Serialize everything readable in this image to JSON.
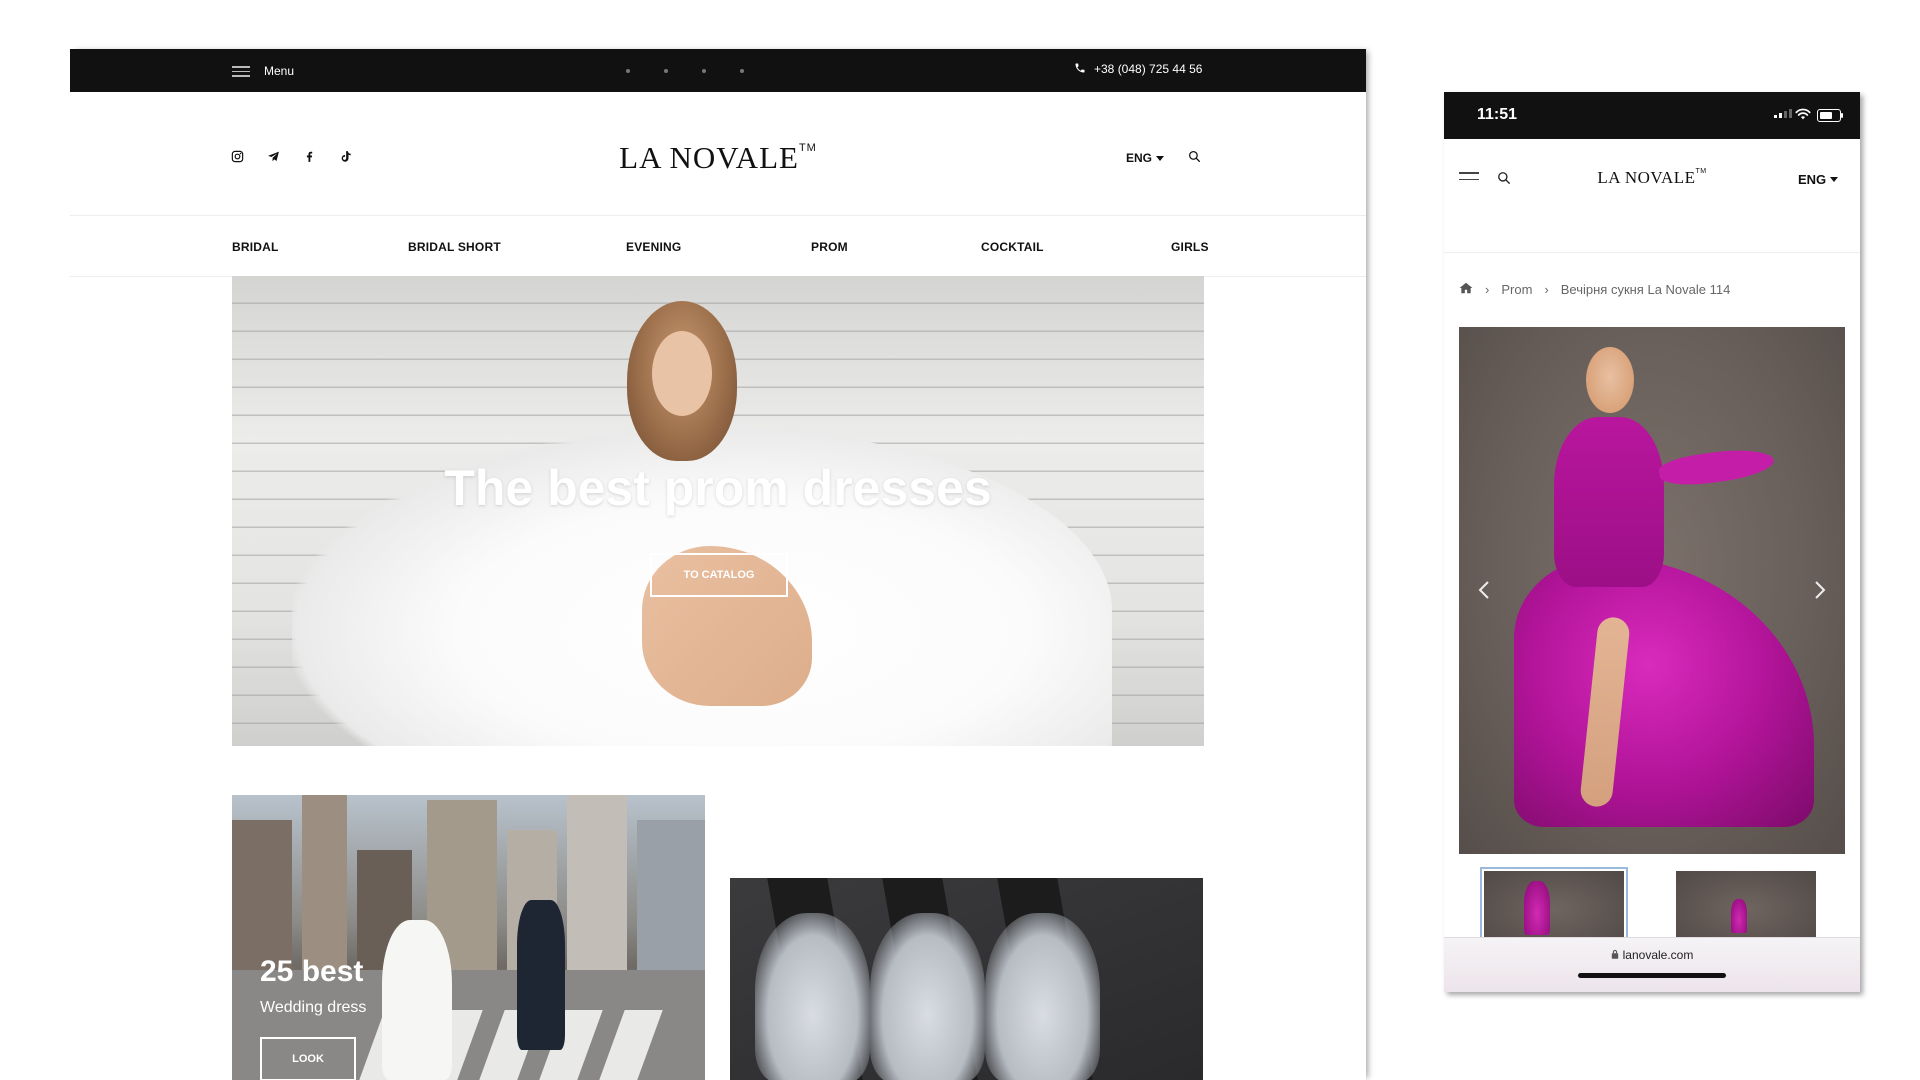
{
  "desktop": {
    "topbar": {
      "menu_label": "Menu",
      "phone": "+38 (048) 725 44 56"
    },
    "header": {
      "logo": "LA NOVALE",
      "logo_tm": "TM",
      "language": "ENG",
      "socials": [
        "instagram-icon",
        "telegram-icon",
        "facebook-icon",
        "tiktok-icon"
      ]
    },
    "nav": [
      "BRIDAL",
      "BRIDAL SHORT",
      "EVENING",
      "PROM",
      "COCKTAIL",
      "GIRLS"
    ],
    "hero": {
      "title": "The best prom dresses",
      "button": "TO CATALOG"
    },
    "cards": [
      {
        "title": "25 best",
        "subtitle": "Wedding dress",
        "button": "LOOK"
      }
    ]
  },
  "phone": {
    "status": {
      "time": "11:51"
    },
    "header": {
      "logo": "LA NOVALE",
      "logo_tm": "TM",
      "language": "ENG"
    },
    "breadcrumb": {
      "category": "Prom",
      "current": "Вечірня сукня La Novale 114"
    },
    "url": "lanovale.com"
  },
  "colors": {
    "topbar": "#111111",
    "product_accent": "#b3149a"
  }
}
